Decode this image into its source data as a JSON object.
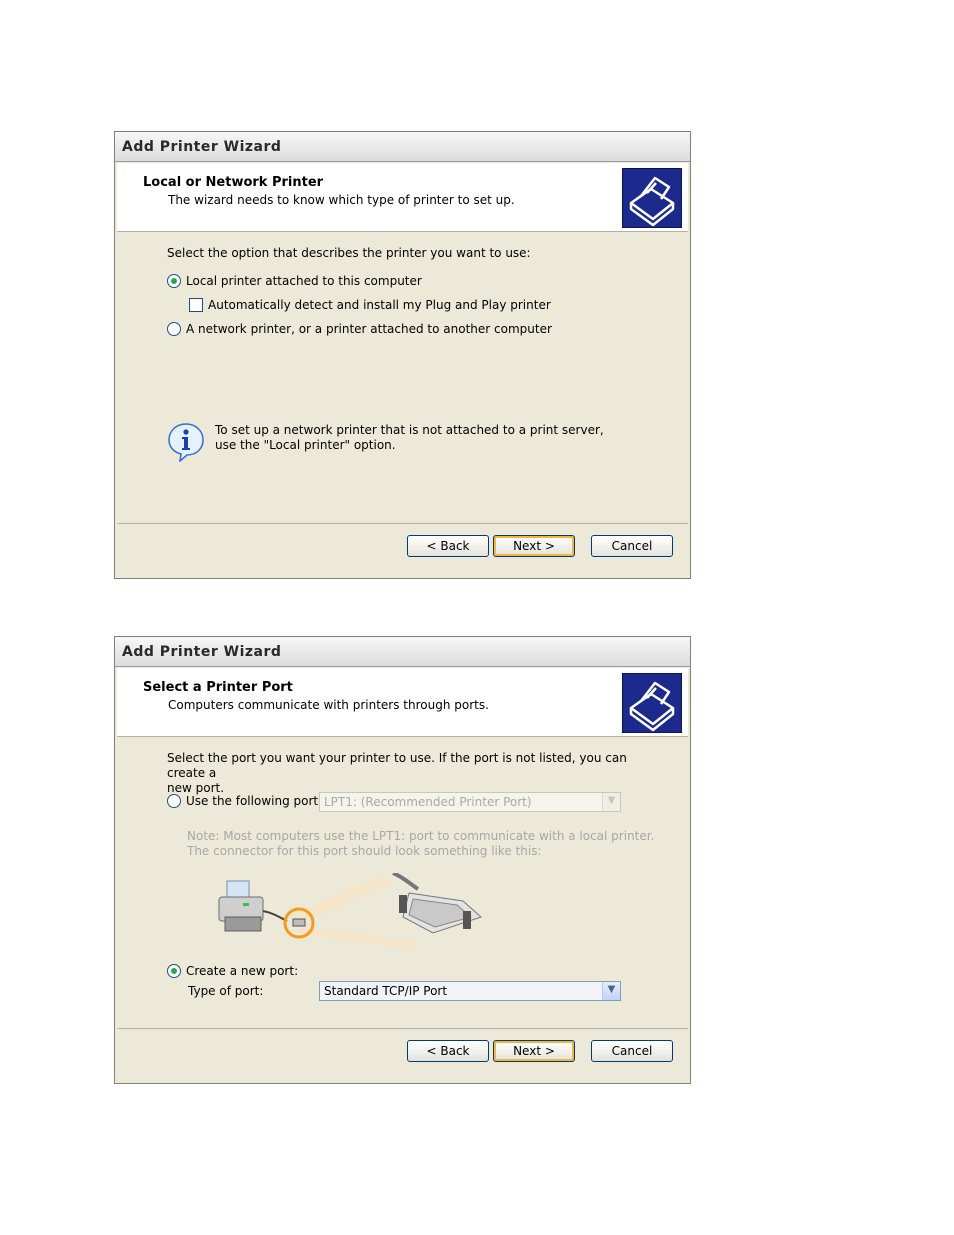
{
  "dialog1": {
    "title": "Add Printer Wizard",
    "header_title": "Local or Network Printer",
    "header_sub": "The wizard needs to know which type of printer to set up.",
    "intro": "Select the option that describes the printer you want to use:",
    "option_local": "Local printer attached to this computer",
    "option_local_selected": true,
    "check_plugplay": "Automatically detect and install my Plug and Play printer",
    "check_plugplay_checked": false,
    "option_network": "A network printer, or a printer attached to another computer",
    "info_line1": "To set up a network printer that is not attached to a print server,",
    "info_line2": "use the \"Local printer\" option.",
    "back": "< Back",
    "next": "Next >",
    "cancel": "Cancel"
  },
  "dialog2": {
    "title": "Add Printer Wizard",
    "header_title": "Select a Printer Port",
    "header_sub": "Computers communicate with printers through ports.",
    "intro_line1": "Select the port you want your printer to use.  If the port is not listed, you can create a",
    "intro_line2": "new port.",
    "option_use_port": "Use the following port:",
    "use_port_value": "LPT1: (Recommended Printer Port)",
    "note_line1": "Note: Most computers use the LPT1: port to communicate with a local printer.",
    "note_line2": "The connector for this port should look something like this:",
    "option_create_port": "Create a new port:",
    "create_port_selected": true,
    "type_of_port_label": "Type of port:",
    "type_of_port_value": "Standard TCP/IP Port",
    "back": "< Back",
    "next": "Next >",
    "cancel": "Cancel"
  },
  "icons": {
    "header_logo": "printer-wizard-icon",
    "info": "info-icon",
    "illustration": "printer-parallel-cable-illustration"
  },
  "colors": {
    "dialog_bg": "#ece9d8",
    "logo_bg": "#1b2a8c",
    "default_button_highlight": "#f8b33c",
    "radio_dot": "#2fa34a"
  }
}
